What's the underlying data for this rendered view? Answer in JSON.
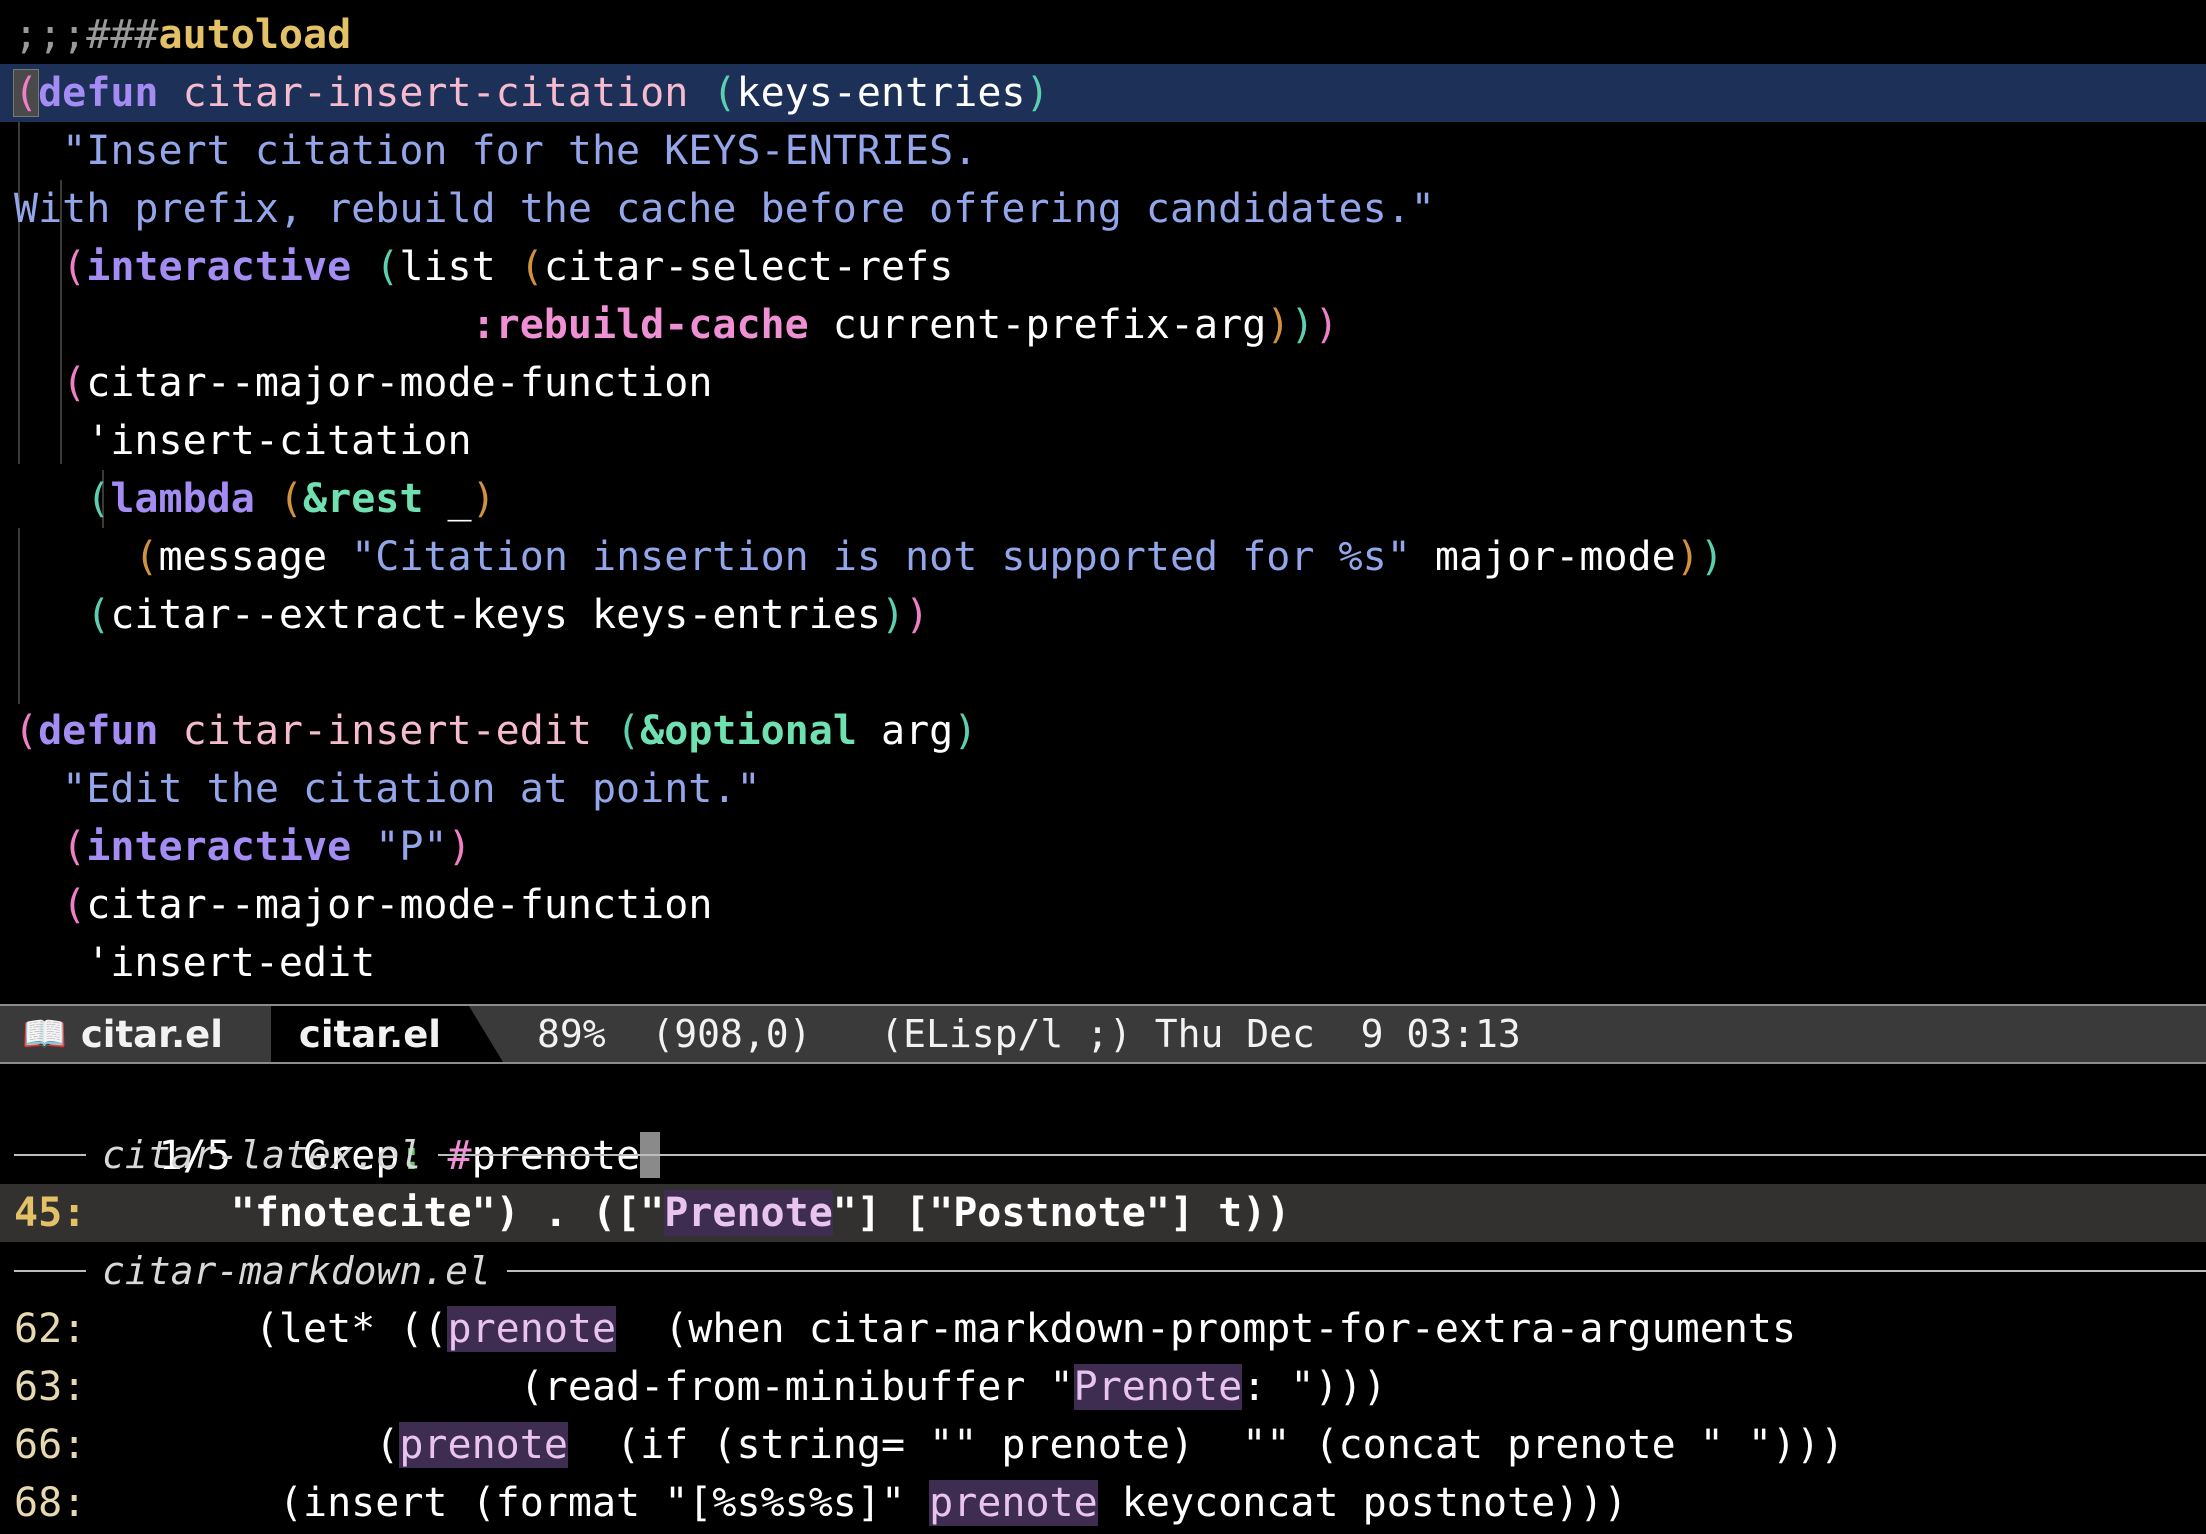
{
  "window": {
    "title": "citar.el",
    "background": "#000000"
  },
  "code_buffer": {
    "lines": [
      {
        "id": "line-autoload",
        "segments": [
          {
            "text": ";;;",
            "cls": "s-comment"
          },
          {
            "text": "###",
            "cls": "s-comment"
          },
          {
            "text": "autoload",
            "cls": "s-autoload"
          }
        ]
      },
      {
        "id": "line-defun-insert-citation",
        "highlight": true,
        "segments": [
          {
            "text": "(",
            "cls": "p1 paren-cursor"
          },
          {
            "text": "defun",
            "cls": "s-kw"
          },
          {
            "text": " citar-insert-citation ",
            "cls": "s-fname"
          },
          {
            "text": "(",
            "cls": "p2"
          },
          {
            "text": "keys-entries",
            "cls": "s-plain"
          },
          {
            "text": ")",
            "cls": "p2"
          }
        ]
      },
      {
        "id": "line-docstring-1",
        "segments": [
          {
            "text": "  \"Insert citation for the KEYS-ENTRIES.",
            "cls": "s-str"
          }
        ]
      },
      {
        "id": "line-docstring-2",
        "segments": [
          {
            "text": "With prefix, rebuild the cache before offering candidates.\"",
            "cls": "s-str"
          }
        ]
      },
      {
        "id": "line-interactive",
        "segments": [
          {
            "text": "  ",
            "cls": "s-plain"
          },
          {
            "text": "(",
            "cls": "p1"
          },
          {
            "text": "interactive",
            "cls": "s-kw"
          },
          {
            "text": " ",
            "cls": "s-plain"
          },
          {
            "text": "(",
            "cls": "p2"
          },
          {
            "text": "list ",
            "cls": "s-plain"
          },
          {
            "text": "(",
            "cls": "p3"
          },
          {
            "text": "citar-select-refs",
            "cls": "s-plain"
          }
        ]
      },
      {
        "id": "line-rebuild-cache",
        "segments": [
          {
            "text": "                   ",
            "cls": "s-plain"
          },
          {
            "text": ":rebuild-cache",
            "cls": "s-kwarg"
          },
          {
            "text": " current-prefix-arg",
            "cls": "s-plain"
          },
          {
            "text": ")",
            "cls": "p3"
          },
          {
            "text": ")",
            "cls": "p2"
          },
          {
            "text": ")",
            "cls": "p1"
          }
        ]
      },
      {
        "id": "line-major-mode-function-1",
        "segments": [
          {
            "text": "  ",
            "cls": "s-plain"
          },
          {
            "text": "(",
            "cls": "p1"
          },
          {
            "text": "citar--major-mode-function",
            "cls": "s-plain"
          }
        ]
      },
      {
        "id": "line-insert-citation-sym",
        "segments": [
          {
            "text": "   'insert-citation",
            "cls": "s-plain"
          }
        ]
      },
      {
        "id": "line-lambda",
        "segments": [
          {
            "text": "   ",
            "cls": "s-plain"
          },
          {
            "text": "(",
            "cls": "p2"
          },
          {
            "text": "lambda",
            "cls": "s-kw"
          },
          {
            "text": " ",
            "cls": "s-plain"
          },
          {
            "text": "(",
            "cls": "p3"
          },
          {
            "text": "&rest",
            "cls": "s-amp"
          },
          {
            "text": " _",
            "cls": "s-plain"
          },
          {
            "text": ")",
            "cls": "p3"
          }
        ]
      },
      {
        "id": "line-message",
        "segments": [
          {
            "text": "     ",
            "cls": "s-plain"
          },
          {
            "text": "(",
            "cls": "p3"
          },
          {
            "text": "message ",
            "cls": "s-plain"
          },
          {
            "text": "\"Citation insertion is not supported for %s\"",
            "cls": "s-str"
          },
          {
            "text": " major-mode",
            "cls": "s-plain"
          },
          {
            "text": ")",
            "cls": "p3"
          },
          {
            "text": ")",
            "cls": "p2"
          }
        ]
      },
      {
        "id": "line-extract-keys",
        "segments": [
          {
            "text": "   ",
            "cls": "s-plain"
          },
          {
            "text": "(",
            "cls": "p2"
          },
          {
            "text": "citar--extract-keys keys-entries",
            "cls": "s-plain"
          },
          {
            "text": ")",
            "cls": "p2"
          },
          {
            "text": ")",
            "cls": "p1"
          }
        ]
      },
      {
        "id": "line-blank-1",
        "segments": [
          {
            "text": " ",
            "cls": "s-plain"
          }
        ]
      },
      {
        "id": "line-defun-insert-edit",
        "segments": [
          {
            "text": "(",
            "cls": "p1"
          },
          {
            "text": "defun",
            "cls": "s-kw"
          },
          {
            "text": " citar-insert-edit ",
            "cls": "s-fname"
          },
          {
            "text": "(",
            "cls": "p2"
          },
          {
            "text": "&optional",
            "cls": "s-amp"
          },
          {
            "text": " arg",
            "cls": "s-plain"
          },
          {
            "text": ")",
            "cls": "p2"
          }
        ]
      },
      {
        "id": "line-edit-docstring",
        "segments": [
          {
            "text": "  \"Edit the citation at point.\"",
            "cls": "s-str"
          }
        ]
      },
      {
        "id": "line-interactive-P",
        "segments": [
          {
            "text": "  ",
            "cls": "s-plain"
          },
          {
            "text": "(",
            "cls": "p1"
          },
          {
            "text": "interactive",
            "cls": "s-kw"
          },
          {
            "text": " ",
            "cls": "s-plain"
          },
          {
            "text": "\"P\"",
            "cls": "s-str"
          },
          {
            "text": ")",
            "cls": "p1"
          }
        ]
      },
      {
        "id": "line-major-mode-function-2",
        "segments": [
          {
            "text": "  ",
            "cls": "s-plain"
          },
          {
            "text": "(",
            "cls": "p1"
          },
          {
            "text": "citar--major-mode-function",
            "cls": "s-plain"
          }
        ]
      },
      {
        "id": "line-insert-edit-sym",
        "segments": [
          {
            "text": "   'insert-edit",
            "cls": "s-plain"
          }
        ]
      }
    ]
  },
  "modeline": {
    "icon": "book-icon",
    "icon_glyph": "📖",
    "buffer_name_left": "citar.el",
    "buffer_name_right": "citar.el",
    "position_percent": "89%",
    "position_point": "(908,0)",
    "major_mode": "(ELisp/l ;)",
    "datetime": "Thu Dec  9 03:13"
  },
  "minibuffer": {
    "match_count": "1/5",
    "prompt_label": "Grep",
    "prompt_colon": ":",
    "input_hash": "#",
    "input_value": "prenote",
    "placeholder": "Grep:"
  },
  "results": {
    "groups": [
      {
        "file": "citar-latex.el",
        "rows": [
          {
            "lineno": "45:",
            "selected": true,
            "segments": [
              {
                "text": "      \"fnotecite\") . ([\"",
                "match": false
              },
              {
                "text": "Prenote",
                "match": true
              },
              {
                "text": "\"] [\"Postnote\"] t))",
                "match": false
              }
            ]
          }
        ]
      },
      {
        "file": "citar-markdown.el",
        "rows": [
          {
            "lineno": "62:",
            "selected": false,
            "segments": [
              {
                "text": "       (let* ((",
                "match": false
              },
              {
                "text": "prenote",
                "match": true
              },
              {
                "text": "  (when citar-markdown-prompt-for-extra-arguments",
                "match": false
              }
            ]
          },
          {
            "lineno": "63:",
            "selected": false,
            "segments": [
              {
                "text": "                  (read-from-minibuffer \"",
                "match": false
              },
              {
                "text": "Prenote",
                "match": true
              },
              {
                "text": ": \")))",
                "match": false
              }
            ]
          },
          {
            "lineno": "66:",
            "selected": false,
            "segments": [
              {
                "text": "            (",
                "match": false
              },
              {
                "text": "prenote",
                "match": true
              },
              {
                "text": "  (if (string= \"\" prenote)  \"\" (concat prenote \" \")))",
                "match": false
              }
            ]
          },
          {
            "lineno": "68:",
            "selected": false,
            "segments": [
              {
                "text": "        (insert (format \"[%s%s%s]\" ",
                "match": false
              },
              {
                "text": "prenote",
                "match": true
              },
              {
                "text": " keyconcat postnote)))",
                "match": false
              }
            ]
          }
        ]
      }
    ]
  },
  "colors": {
    "background": "#000000",
    "highlight_line": "#1c3058",
    "modeline_bg": "#3a3a3a",
    "modeline_border": "#8c8c8c",
    "match_highlight_bg": "#3e2d50",
    "match_highlight_fg": "#e8c4ee",
    "selected_row_bg": "#333030",
    "lineno_fg": "#e6d8b0",
    "accent_keyword": "#a48cf2",
    "accent_string": "#94a6ea",
    "accent_autoload": "#e3c167"
  }
}
